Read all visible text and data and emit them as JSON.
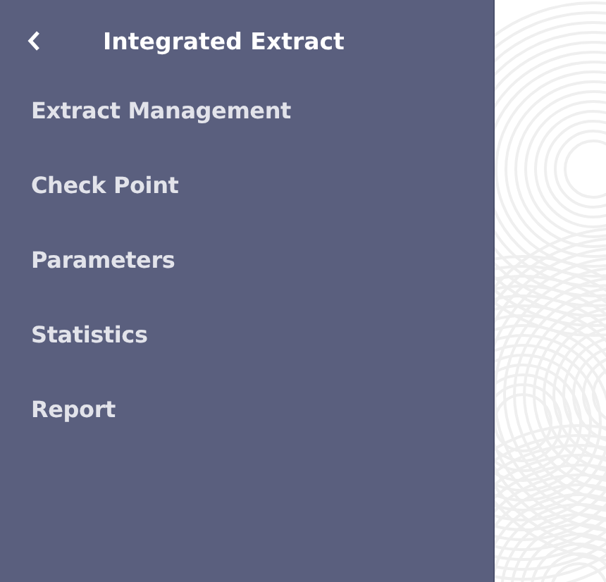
{
  "header": {
    "title": "Integrated Extract"
  },
  "menu": {
    "items": [
      {
        "label": "Extract Management"
      },
      {
        "label": "Check Point"
      },
      {
        "label": "Parameters"
      },
      {
        "label": "Statistics"
      },
      {
        "label": "Report"
      }
    ]
  }
}
